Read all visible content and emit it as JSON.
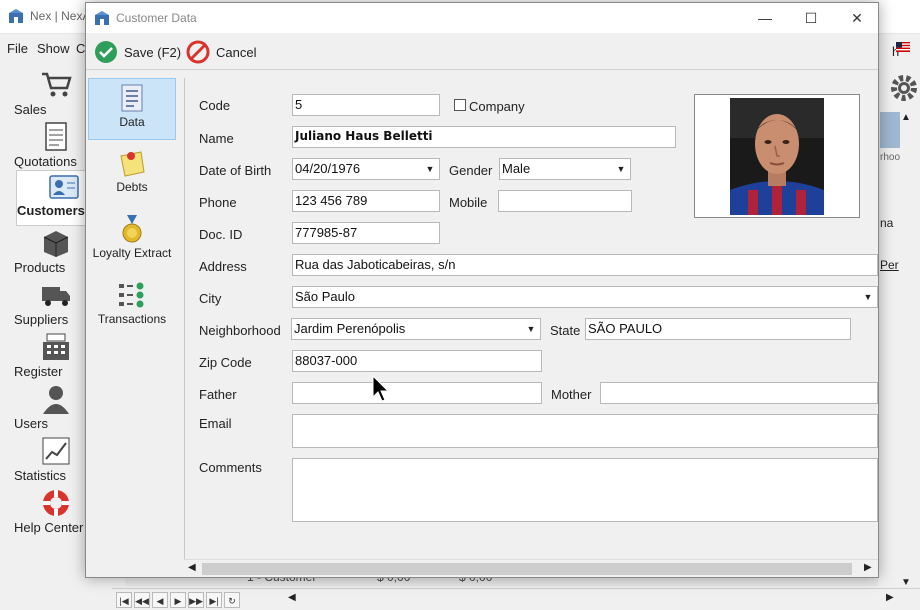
{
  "background": {
    "title": "Nex | NexA",
    "menu": [
      "File",
      "Show",
      "C"
    ],
    "sidebar": [
      "Sales",
      "Quotations",
      "Customers",
      "Products",
      "Suppliers",
      "Register",
      "Users",
      "Statistics",
      "Help Center"
    ],
    "grid_row": {
      "col1": "1 - Customer",
      "col2": "$ 0,00",
      "col3": "$ 0,00"
    },
    "right_fragments": {
      "hood": "rhoo",
      "na": "na",
      "per": "Per",
      "h": "h"
    }
  },
  "dialog": {
    "title": "Customer Data",
    "toolbar": {
      "save_label": "Save (F2)",
      "cancel_label": "Cancel"
    },
    "nav": [
      "Data",
      "Debts",
      "Loyalty Extract",
      "Transactions"
    ],
    "form": {
      "code_label": "Code",
      "code_value": "5",
      "company_label": "Company",
      "name_label": "Name",
      "name_value": "Juliano Haus Belletti",
      "dob_label": "Date of Birth",
      "dob_value": "04/20/1976",
      "gender_label": "Gender",
      "gender_value": "Male",
      "phone_label": "Phone",
      "phone_value": "123 456 789",
      "mobile_label": "Mobile",
      "mobile_value": "",
      "docid_label": "Doc. ID",
      "docid_value": "777985-87",
      "address_label": "Address",
      "address_value": "Rua das Jaboticabeiras, s/n",
      "city_label": "City",
      "city_value": "São Paulo",
      "neighborhood_label": "Neighborhood",
      "neighborhood_value": "Jardim Perenópolis",
      "state_label": "State",
      "state_value": "SÃO PAULO",
      "zip_label": "Zip Code",
      "zip_value": "88037-000",
      "father_label": "Father",
      "father_value": "",
      "mother_label": "Mother",
      "mother_value": "",
      "email_label": "Email",
      "comments_label": "Comments"
    }
  },
  "colors": {
    "accent": "#cce4f7",
    "save_green": "#2e9e5b",
    "cancel_red": "#d9342b"
  }
}
